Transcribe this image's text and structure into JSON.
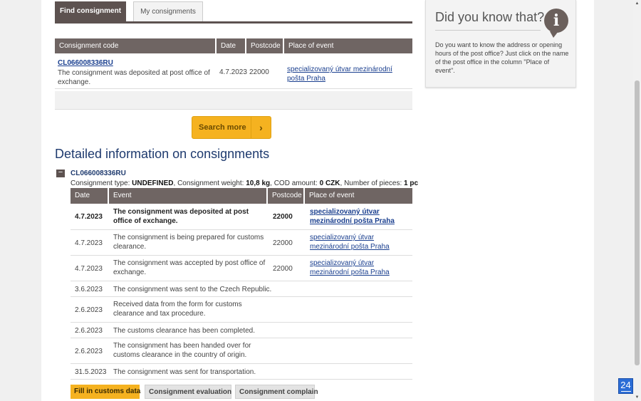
{
  "tabs": {
    "find": "Find consignment",
    "mine": "My consignments"
  },
  "summary": {
    "headers": [
      "Consignment code",
      "Date",
      "Postcode",
      "Place of event"
    ],
    "row": {
      "code": "CL066008336RU",
      "description": "The consignment was deposited at post office of exchange.",
      "date": "4.7.2023",
      "postcode": "22000",
      "place": "specializovaný útvar mezinárodní pošta Praha"
    }
  },
  "search_more": "Search more",
  "detail": {
    "title": "Detailed information on consignments",
    "toggle": "−",
    "code": "CL066008336RU",
    "info": {
      "type_label": "Consignment type: ",
      "type_value": "UNDEFINED",
      "weight_label": ", Consignment weight: ",
      "weight_value": "10,8 kg",
      "cod_label": ", COD amount: ",
      "cod_value": "0 CZK",
      "pieces_label": ", Number of pieces: ",
      "pieces_value": "1 pc"
    },
    "headers": [
      "Date",
      "Event",
      "Postcode",
      "Place of event"
    ],
    "rows": [
      {
        "date": "4.7.2023",
        "event": "The consignment was deposited at post office of exchange.",
        "postcode": "22000",
        "place": "specializovaný útvar mezinárodní pošta Praha"
      },
      {
        "date": "4.7.2023",
        "event": "The consignment is being prepared for customs clearance.",
        "postcode": "22000",
        "place": "specializovaný útvar mezinárodní pošta Praha"
      },
      {
        "date": "4.7.2023",
        "event": "The consignment was accepted by post office of exchange.",
        "postcode": "22000",
        "place": "specializovaný útvar mezinárodní pošta Praha"
      },
      {
        "date": "3.6.2023",
        "event": "The consignment was sent to the Czech Republic.",
        "postcode": "",
        "place": ""
      },
      {
        "date": "2.6.2023",
        "event": "Received data from the form for customs clearance and tax procedure.",
        "postcode": "",
        "place": ""
      },
      {
        "date": "2.6.2023",
        "event": "The customs clearance has been completed.",
        "postcode": "",
        "place": ""
      },
      {
        "date": "2.6.2023",
        "event": "The consignment has been handed over for customs clearance in the country of origin.",
        "postcode": "",
        "place": ""
      },
      {
        "date": "31.5.2023",
        "event": "The consignment was sent for transportation.",
        "postcode": "",
        "place": ""
      }
    ],
    "buttons": {
      "customs": "Fill in customs data",
      "evaluation": "Consignment evaluation",
      "complain": "Consignment complain"
    }
  },
  "sidebar": {
    "title": "Did you know that?",
    "icon": "info-icon",
    "text": "Do you want to know the address or opening hours of the post office? Just click on the name of the post office in the column \"Place of event\"."
  },
  "badge": "24",
  "colors": {
    "accent": "#f5b220",
    "header": "#6f6563",
    "link": "#1a3f8f",
    "title": "#1e3a6e"
  }
}
